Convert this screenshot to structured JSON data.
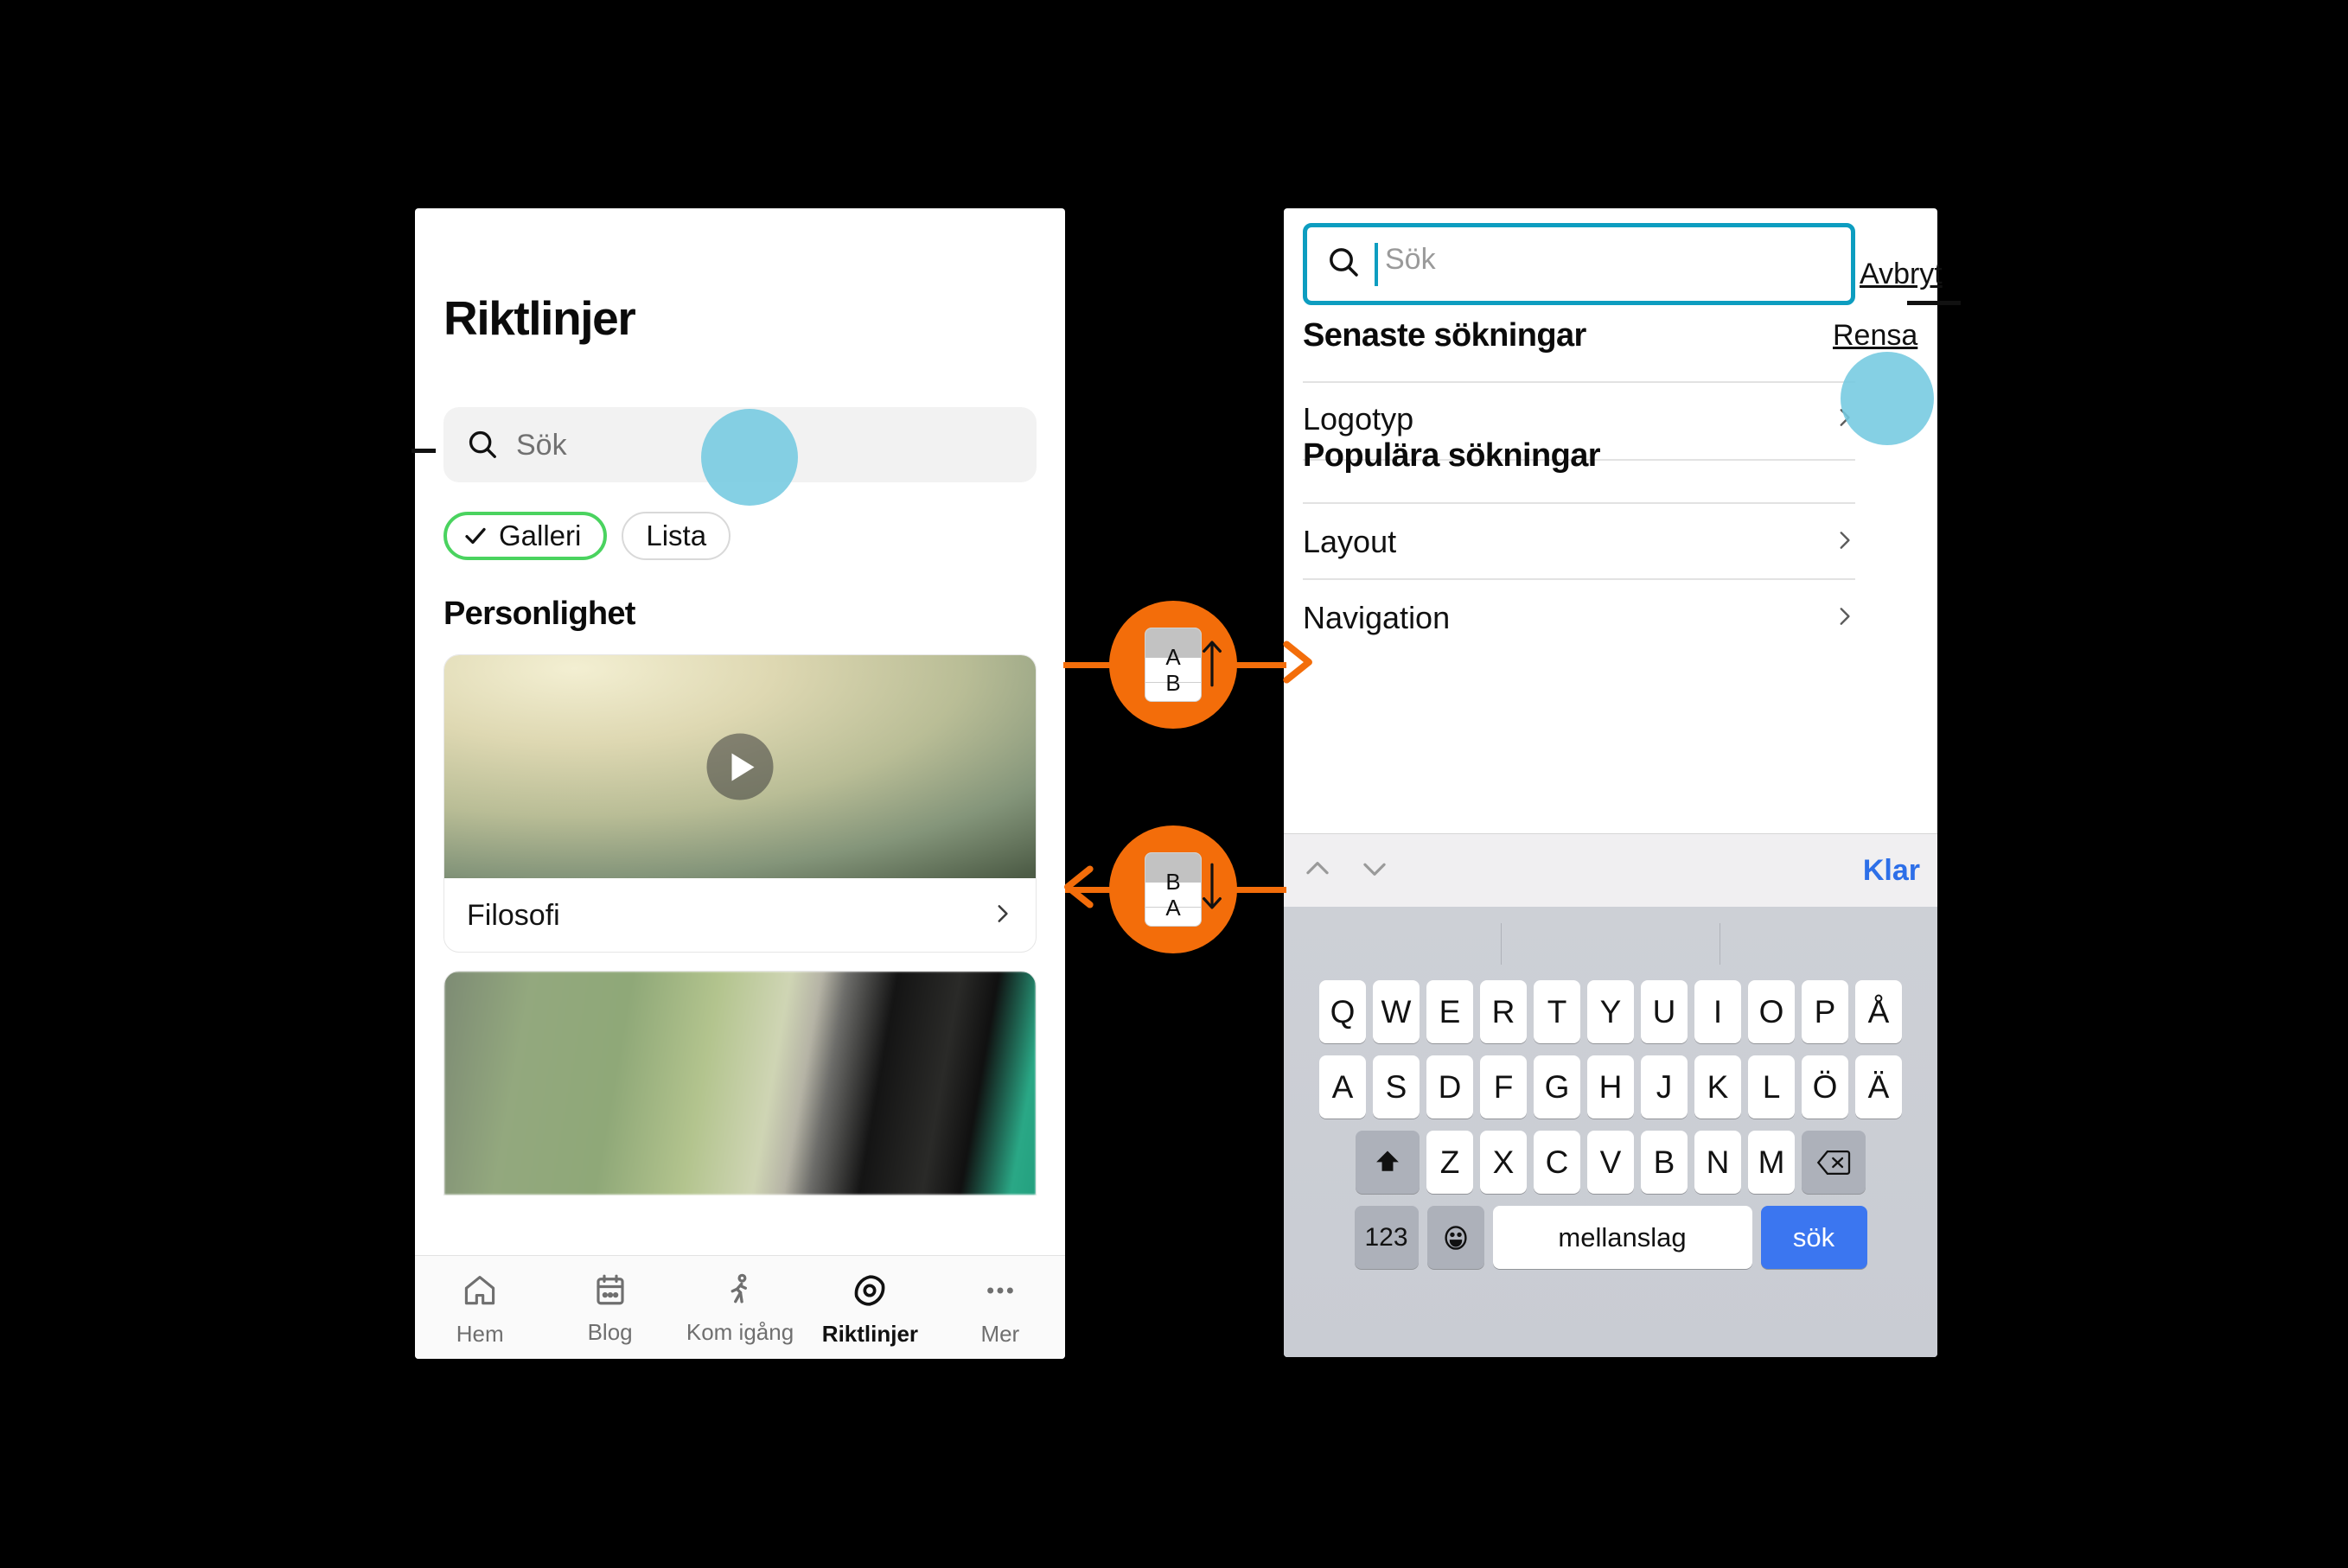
{
  "left_phone": {
    "title": "Riktlinjer",
    "search": {
      "placeholder": "Sök",
      "icon": "search-icon"
    },
    "chips": [
      {
        "label": "Galleri",
        "selected": true,
        "icon": "check-icon"
      },
      {
        "label": "Lista",
        "selected": false
      }
    ],
    "section_heading": "Personlighet",
    "cards": [
      {
        "label": "Filosofi",
        "chevron": "chevron-right-icon",
        "media": "video-thumbnail",
        "play": "play-icon"
      },
      {
        "label": "",
        "media": "image-thumbnail"
      }
    ],
    "tabbar": [
      {
        "label": "Hem",
        "icon": "home-icon",
        "active": false
      },
      {
        "label": "Blog",
        "icon": "calendar-icon",
        "active": false
      },
      {
        "label": "Kom igång",
        "icon": "walking-person-icon",
        "active": false
      },
      {
        "label": "Riktlinjer",
        "icon": "eye-target-icon",
        "active": true
      },
      {
        "label": "Mer",
        "icon": "ellipsis-icon",
        "active": false
      }
    ]
  },
  "right_phone": {
    "search": {
      "placeholder": "Sök",
      "value": "",
      "icon": "search-icon",
      "focused": true
    },
    "cancel_label": "Avbryt",
    "recent": {
      "heading": "Senaste sökningar",
      "clear_label": "Rensa",
      "items": [
        {
          "label": "Logotyp",
          "chevron": "chevron-right-icon"
        }
      ]
    },
    "popular": {
      "heading": "Populära sökningar",
      "items": [
        {
          "label": "Layout",
          "chevron": "chevron-right-icon"
        },
        {
          "label": "Navigation",
          "chevron": "chevron-right-icon"
        }
      ]
    },
    "accessory": {
      "prev_icon": "chevron-up-icon",
      "next_icon": "chevron-down-icon",
      "done_label": "Klar"
    },
    "keyboard": {
      "row1": [
        "Q",
        "W",
        "E",
        "R",
        "T",
        "Y",
        "U",
        "I",
        "O",
        "P",
        "Å"
      ],
      "row2": [
        "A",
        "S",
        "D",
        "F",
        "G",
        "H",
        "J",
        "K",
        "L",
        "Ö",
        "Ä"
      ],
      "row3": [
        "Z",
        "X",
        "C",
        "V",
        "B",
        "N",
        "M"
      ],
      "shift_icon": "shift-up-arrow-icon",
      "backspace_icon": "backspace-delete-icon",
      "numbers_label": "123",
      "emoji_icon": "smiley-face-icon",
      "space_label": "mellanslag",
      "return_label": "sök"
    }
  },
  "annotations": {
    "badges": [
      {
        "letters_top": "A",
        "letters_bottom": "B",
        "arrow": "arrow-up-icon",
        "direction": "right"
      },
      {
        "letters_top": "B",
        "letters_bottom": "A",
        "arrow": "arrow-down-icon",
        "direction": "left"
      }
    ],
    "accent_color": "#f36d0a",
    "touch_indicator_color": "#74c9e0",
    "focus_color": "#0d9dc0",
    "selected_chip_color": "#4ad35f"
  }
}
